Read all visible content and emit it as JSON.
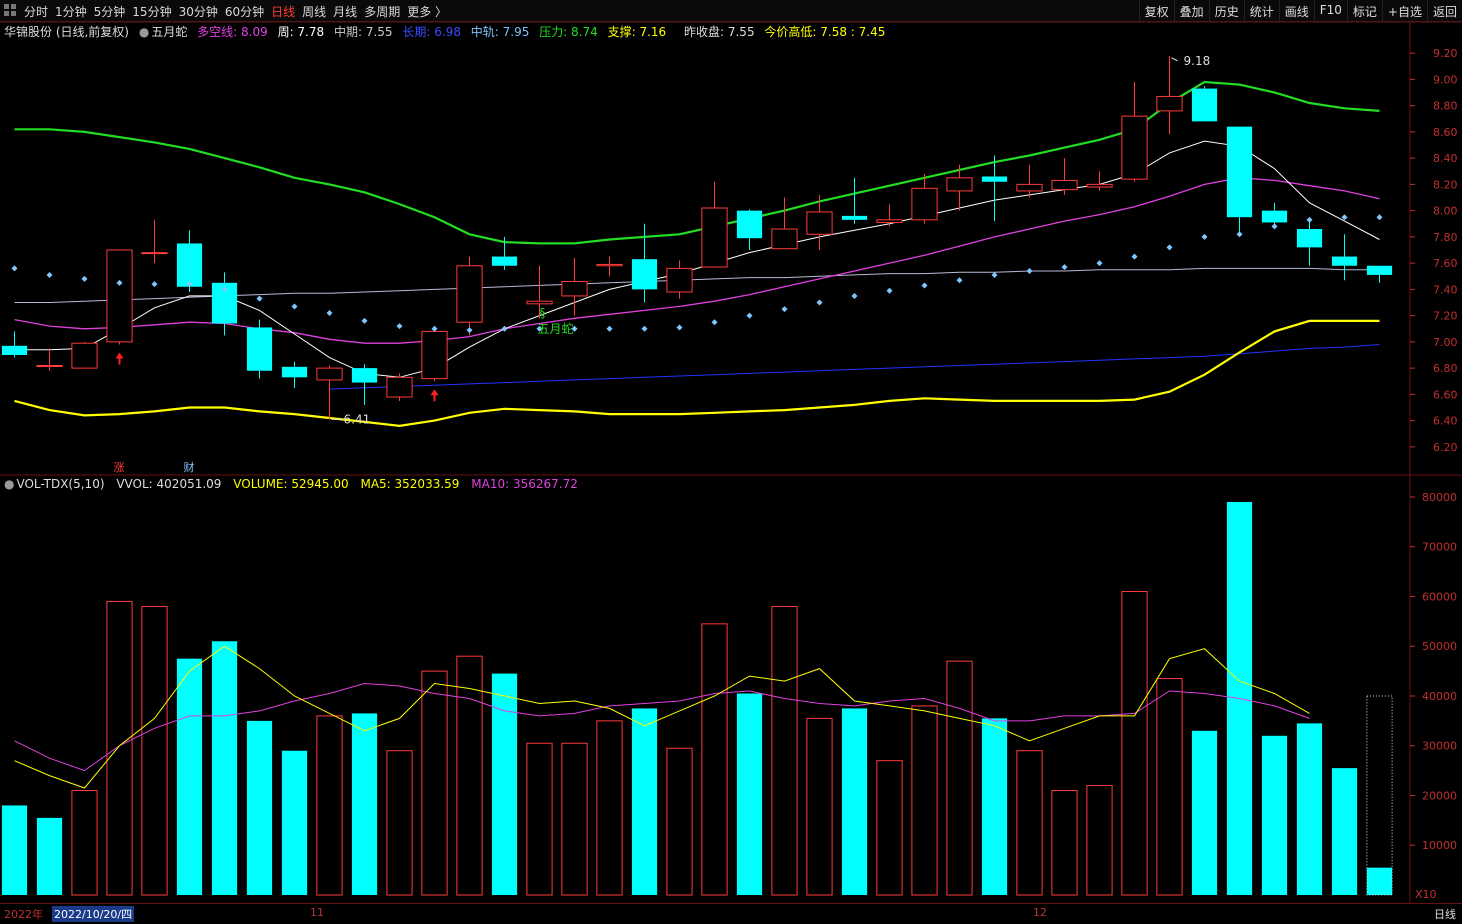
{
  "toolbar": {
    "tabs": [
      "分时",
      "1分钟",
      "5分钟",
      "15分钟",
      "30分钟",
      "60分钟",
      "日线",
      "周线",
      "月线",
      "多周期",
      "更多 〉"
    ],
    "active_index": 6,
    "right_buttons": [
      "复权",
      "叠加",
      "历史",
      "统计",
      "画线",
      "F10",
      "标记",
      "+自选",
      "返回"
    ]
  },
  "price_info": {
    "stock": "华锦股份 (日线,前复权)",
    "indicator": "五月蛇",
    "duokong": "多空线: 8.09",
    "zhou": "周: 7.78",
    "zhongqi": "中期: 7.55",
    "changqi": "长期: 6.98",
    "zhonggui": "中轨: 7.95",
    "yali": "压力: 8.74",
    "zhicheng": "支撑: 7.16",
    "prev_close": "昨收盘: 7.55",
    "today_hl": "今价高低: 7.58 : 7.45"
  },
  "volume_info": {
    "name": "VOL-TDX(5,10)",
    "vvol": "VVOL: 402051.09",
    "volume": "VOLUME: 52945.00",
    "ma5": "MA5: 352033.59",
    "ma10": "MA10: 356267.72"
  },
  "annotations": {
    "high_label": "9.18",
    "low_label": "6.41",
    "signal_label": "五月蛇",
    "mark_zhang": "涨",
    "mark_cai": "财",
    "x10": "X10"
  },
  "bottom": {
    "year": "2022年",
    "cursor_date": "2022/10/20/四",
    "month_11": "11",
    "month_12": "12",
    "period": "日线"
  },
  "colors": {
    "up": "#ff3b3b",
    "down": "#00ffff",
    "green_band": "#22dd22",
    "yellow_band": "#ffff00",
    "white_line": "#ffffff",
    "magenta_line": "#e040e0",
    "blue_line": "#2233ff",
    "axis": "#c03030"
  },
  "chart_data": [
    {
      "type": "candlestick",
      "y_ticks": [
        "9.20",
        "9.00",
        "8.80",
        "8.60",
        "8.40",
        "8.20",
        "8.00",
        "7.80",
        "7.60",
        "7.40",
        "7.20",
        "7.00",
        "6.80",
        "6.60",
        "6.40",
        "6.20"
      ],
      "ylim": [
        6.1,
        9.3
      ],
      "candles": [
        {
          "o": 6.97,
          "h": 7.08,
          "l": 6.88,
          "c": 6.9
        },
        {
          "o": 6.82,
          "h": 6.95,
          "l": 6.78,
          "c": 6.82
        },
        {
          "o": 6.8,
          "h": 7.0,
          "l": 6.8,
          "c": 6.99
        },
        {
          "o": 7.0,
          "h": 7.7,
          "l": 6.98,
          "c": 7.7
        },
        {
          "o": 7.68,
          "h": 7.93,
          "l": 7.6,
          "c": 7.68
        },
        {
          "o": 7.75,
          "h": 7.85,
          "l": 7.38,
          "c": 7.42
        },
        {
          "o": 7.45,
          "h": 7.53,
          "l": 7.05,
          "c": 7.14
        },
        {
          "o": 7.11,
          "h": 7.17,
          "l": 6.72,
          "c": 6.78
        },
        {
          "o": 6.81,
          "h": 6.85,
          "l": 6.65,
          "c": 6.73
        },
        {
          "o": 6.71,
          "h": 6.82,
          "l": 6.41,
          "c": 6.8
        },
        {
          "o": 6.8,
          "h": 6.83,
          "l": 6.52,
          "c": 6.69
        },
        {
          "o": 6.58,
          "h": 6.76,
          "l": 6.55,
          "c": 6.73
        },
        {
          "o": 6.72,
          "h": 7.08,
          "l": 6.7,
          "c": 7.08
        },
        {
          "o": 7.15,
          "h": 7.65,
          "l": 7.05,
          "c": 7.58
        },
        {
          "o": 7.65,
          "h": 7.8,
          "l": 7.55,
          "c": 7.58
        },
        {
          "o": 7.29,
          "h": 7.58,
          "l": 7.18,
          "c": 7.31
        },
        {
          "o": 7.35,
          "h": 7.64,
          "l": 7.2,
          "c": 7.46
        },
        {
          "o": 7.58,
          "h": 7.65,
          "l": 7.5,
          "c": 7.59
        },
        {
          "o": 7.63,
          "h": 7.9,
          "l": 7.3,
          "c": 7.4
        },
        {
          "o": 7.38,
          "h": 7.62,
          "l": 7.33,
          "c": 7.56
        },
        {
          "o": 7.57,
          "h": 8.22,
          "l": 7.57,
          "c": 8.02
        },
        {
          "o": 8.0,
          "h": 8.01,
          "l": 7.7,
          "c": 7.79
        },
        {
          "o": 7.71,
          "h": 8.1,
          "l": 7.71,
          "c": 7.86
        },
        {
          "o": 7.82,
          "h": 8.12,
          "l": 7.7,
          "c": 7.99
        },
        {
          "o": 7.96,
          "h": 8.25,
          "l": 7.9,
          "c": 7.93
        },
        {
          "o": 7.91,
          "h": 8.05,
          "l": 7.88,
          "c": 7.93
        },
        {
          "o": 7.93,
          "h": 8.28,
          "l": 7.9,
          "c": 8.17
        },
        {
          "o": 8.15,
          "h": 8.35,
          "l": 8.0,
          "c": 8.25
        },
        {
          "o": 8.26,
          "h": 8.42,
          "l": 7.92,
          "c": 8.22
        },
        {
          "o": 8.15,
          "h": 8.35,
          "l": 8.1,
          "c": 8.2
        },
        {
          "o": 8.16,
          "h": 8.4,
          "l": 8.12,
          "c": 8.23
        },
        {
          "o": 8.18,
          "h": 8.3,
          "l": 8.15,
          "c": 8.2
        },
        {
          "o": 8.24,
          "h": 8.98,
          "l": 8.22,
          "c": 8.72
        },
        {
          "o": 8.76,
          "h": 9.18,
          "l": 8.58,
          "c": 8.87
        },
        {
          "o": 8.93,
          "h": 8.95,
          "l": 8.68,
          "c": 8.68
        },
        {
          "o": 8.64,
          "h": 8.64,
          "l": 7.8,
          "c": 7.95
        },
        {
          "o": 8.0,
          "h": 8.06,
          "l": 7.86,
          "c": 7.91
        },
        {
          "o": 7.86,
          "h": 7.92,
          "l": 7.58,
          "c": 7.72
        },
        {
          "o": 7.65,
          "h": 7.82,
          "l": 7.47,
          "c": 7.58
        },
        {
          "o": 7.58,
          "h": 7.58,
          "l": 7.45,
          "c": 7.51
        }
      ],
      "lines": {
        "green_band": [
          8.62,
          8.62,
          8.6,
          8.56,
          8.52,
          8.47,
          8.4,
          8.33,
          8.25,
          8.2,
          8.14,
          8.05,
          7.95,
          7.82,
          7.76,
          7.75,
          7.75,
          7.78,
          7.8,
          7.82,
          7.88,
          7.94,
          8.0,
          8.07,
          8.13,
          8.19,
          8.25,
          8.31,
          8.37,
          8.42,
          8.48,
          8.54,
          8.62,
          8.82,
          8.98,
          8.96,
          8.9,
          8.82,
          8.78,
          8.76
        ],
        "yellow_band": [
          6.55,
          6.48,
          6.44,
          6.45,
          6.47,
          6.5,
          6.5,
          6.47,
          6.45,
          6.42,
          6.39,
          6.36,
          6.4,
          6.46,
          6.49,
          6.48,
          6.47,
          6.45,
          6.45,
          6.45,
          6.46,
          6.47,
          6.48,
          6.5,
          6.52,
          6.55,
          6.57,
          6.56,
          6.55,
          6.55,
          6.55,
          6.55,
          6.56,
          6.62,
          6.75,
          6.92,
          7.08,
          7.16,
          7.16,
          7.16
        ],
        "white_ma": [
          6.94,
          6.94,
          6.95,
          7.1,
          7.26,
          7.35,
          7.35,
          7.24,
          7.06,
          6.88,
          6.76,
          6.73,
          6.8,
          6.96,
          7.1,
          7.2,
          7.3,
          7.4,
          7.46,
          7.52,
          7.6,
          7.68,
          7.74,
          7.8,
          7.85,
          7.9,
          7.96,
          8.02,
          8.08,
          8.12,
          8.16,
          8.2,
          8.28,
          8.44,
          8.53,
          8.49,
          8.32,
          8.06,
          7.92,
          7.78
        ],
        "magenta_ma": [
          7.17,
          7.12,
          7.1,
          7.11,
          7.13,
          7.15,
          7.14,
          7.1,
          7.07,
          7.02,
          6.99,
          6.99,
          7.01,
          7.04,
          7.1,
          7.14,
          7.18,
          7.21,
          7.24,
          7.27,
          7.31,
          7.36,
          7.42,
          7.48,
          7.54,
          7.6,
          7.66,
          7.73,
          7.8,
          7.86,
          7.92,
          7.97,
          8.03,
          8.11,
          8.2,
          8.25,
          8.23,
          8.19,
          8.15,
          8.09
        ],
        "gray_long": [
          7.3,
          7.3,
          7.31,
          7.32,
          7.33,
          7.34,
          7.35,
          7.36,
          7.37,
          7.37,
          7.38,
          7.39,
          7.4,
          7.41,
          7.42,
          7.43,
          7.44,
          7.45,
          7.46,
          7.47,
          7.48,
          7.49,
          7.49,
          7.5,
          7.51,
          7.52,
          7.52,
          7.53,
          7.53,
          7.54,
          7.54,
          7.55,
          7.55,
          7.55,
          7.56,
          7.56,
          7.56,
          7.56,
          7.55,
          7.55
        ],
        "blue_long": [
          null,
          null,
          null,
          null,
          null,
          null,
          null,
          null,
          null,
          6.64,
          6.65,
          6.66,
          6.67,
          6.68,
          6.69,
          6.7,
          6.71,
          6.72,
          6.73,
          6.74,
          6.75,
          6.76,
          6.77,
          6.78,
          6.79,
          6.8,
          6.81,
          6.82,
          6.83,
          6.84,
          6.85,
          6.86,
          6.87,
          6.88,
          6.89,
          6.91,
          6.93,
          6.95,
          6.96,
          6.98
        ]
      },
      "dots": [
        7.56,
        7.51,
        7.48,
        7.45,
        7.44,
        7.44,
        7.4,
        7.33,
        7.27,
        7.22,
        7.16,
        7.12,
        7.1,
        7.09,
        7.1,
        7.1,
        7.1,
        7.1,
        7.1,
        7.11,
        7.15,
        7.2,
        7.25,
        7.3,
        7.35,
        7.39,
        7.43,
        7.47,
        7.51,
        7.54,
        7.57,
        7.6,
        7.65,
        7.72,
        7.8,
        7.82,
        7.88,
        7.93,
        7.95,
        7.95
      ],
      "signal_arrows": [
        3,
        12
      ]
    },
    {
      "type": "bar",
      "y_ticks": [
        "80000",
        "70000",
        "60000",
        "50000",
        "40000",
        "30000",
        "20000",
        "10000"
      ],
      "ylim": [
        0,
        81000
      ],
      "volumes": [
        18000,
        15500,
        21000,
        59000,
        58000,
        47500,
        51000,
        35000,
        29000,
        36000,
        36500,
        29000,
        45000,
        48000,
        44500,
        30500,
        30500,
        35000,
        37500,
        29500,
        54500,
        40500,
        58000,
        35500,
        37500,
        27000,
        38000,
        47000,
        35500,
        29000,
        21000,
        22000,
        61000,
        43500,
        33000,
        79000,
        32000,
        34500,
        25500,
        5500
      ],
      "up_flags": [
        false,
        false,
        true,
        true,
        true,
        false,
        false,
        false,
        false,
        true,
        false,
        true,
        true,
        true,
        false,
        true,
        true,
        true,
        false,
        true,
        true,
        false,
        true,
        true,
        false,
        true,
        true,
        true,
        false,
        true,
        true,
        true,
        true,
        true,
        false,
        false,
        false,
        false,
        false,
        false
      ],
      "ma5": [
        27000,
        24000,
        21500,
        30000,
        35500,
        45000,
        50000,
        45500,
        40000,
        36500,
        33000,
        35500,
        42500,
        41500,
        40000,
        38500,
        39000,
        37500,
        34000,
        37000,
        40000,
        44000,
        43000,
        45500,
        39000,
        38000,
        37000,
        35500,
        34000,
        31000,
        33500,
        36000,
        36000,
        47500,
        49500,
        43000,
        40500,
        36500
      ],
      "ma10": [
        31000,
        27500,
        25000,
        30000,
        33500,
        36000,
        36000,
        37000,
        39000,
        40500,
        42500,
        42000,
        40500,
        39500,
        37000,
        36000,
        36500,
        38000,
        38500,
        39000,
        40500,
        41000,
        39500,
        38500,
        38000,
        39000,
        39500,
        37500,
        35000,
        35000,
        36000,
        36000,
        36500,
        41000,
        40500,
        39500,
        38000,
        35500
      ],
      "vol_last_dotted": 40000
    }
  ]
}
